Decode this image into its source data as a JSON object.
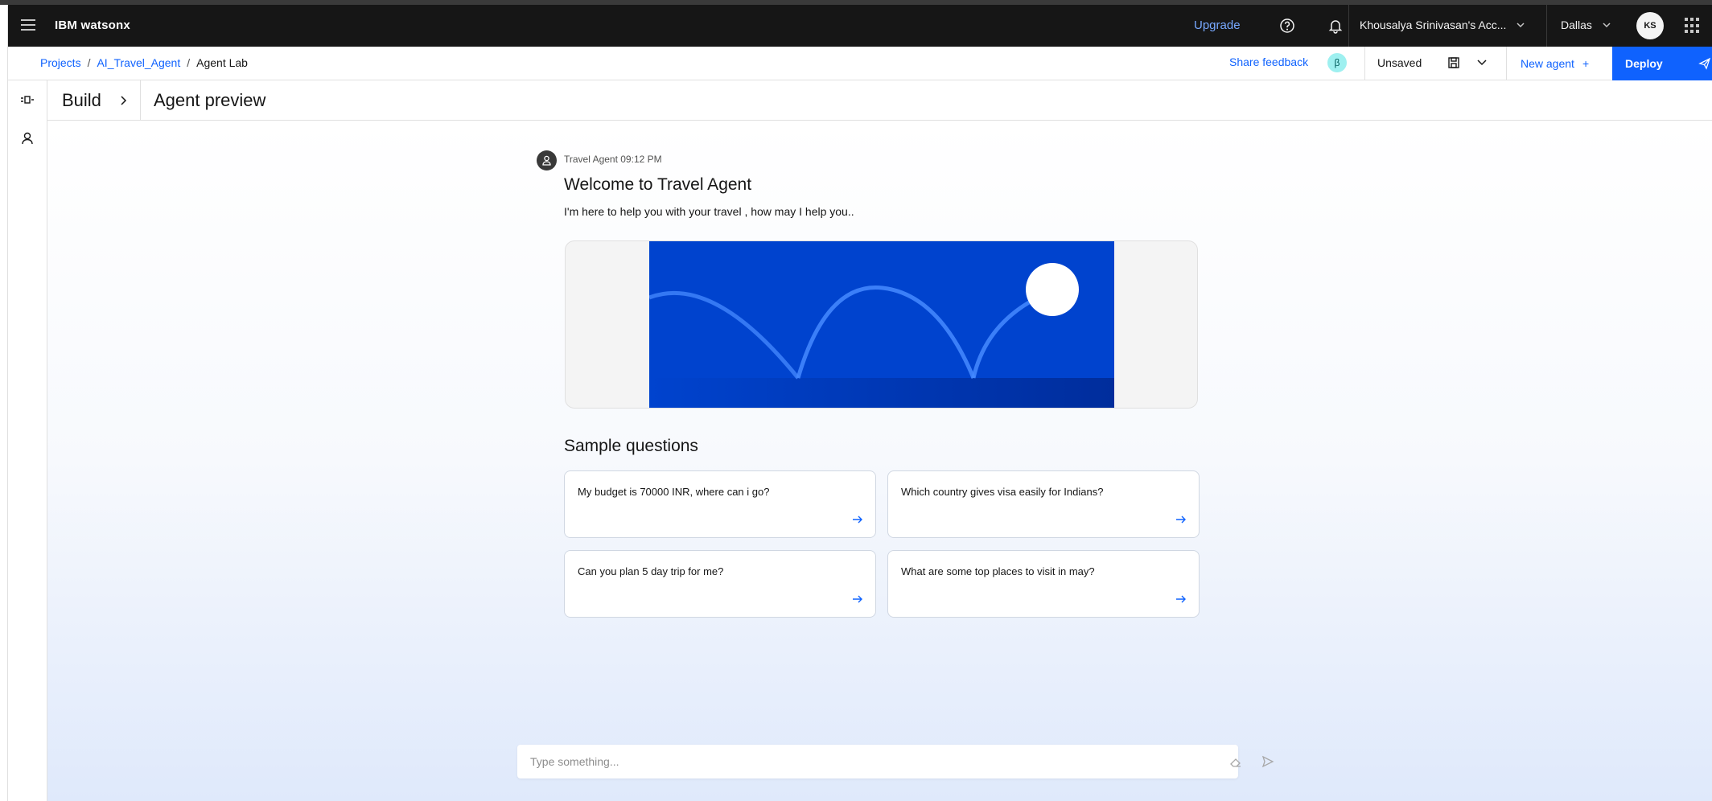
{
  "header": {
    "brand": "IBM watsonx",
    "upgrade": "Upgrade",
    "account": "Khousalya Srinivasan's Acc...",
    "region": "Dallas",
    "avatar_initials": "KS"
  },
  "breadcrumb": {
    "items": [
      "Projects",
      "AI_Travel_Agent"
    ],
    "separator": "/",
    "current": "Agent Lab"
  },
  "toolbar": {
    "share_feedback": "Share feedback",
    "beta": "β",
    "status": "Unsaved",
    "new_agent": "New agent",
    "new_agent_plus": "+",
    "deploy": "Deploy"
  },
  "titlebar": {
    "build": "Build",
    "title": "Agent preview"
  },
  "chat": {
    "meta": "Travel Agent 09:12 PM",
    "welcome": "Welcome to Travel Agent",
    "intro": "I'm here to help you with your travel , how may I help you.."
  },
  "sample_questions": {
    "title": "Sample questions",
    "items": [
      "My budget is 70000 INR, where can i go?",
      "Which country gives visa easily for Indians?",
      "Can you plan 5 day trip for me?",
      "What are some top places to visit in may?"
    ]
  },
  "input": {
    "placeholder": "Type something..."
  },
  "colors": {
    "brand_blue": "#0f62fe",
    "header_bg": "#161616",
    "hero_blue": "#0043ce"
  }
}
